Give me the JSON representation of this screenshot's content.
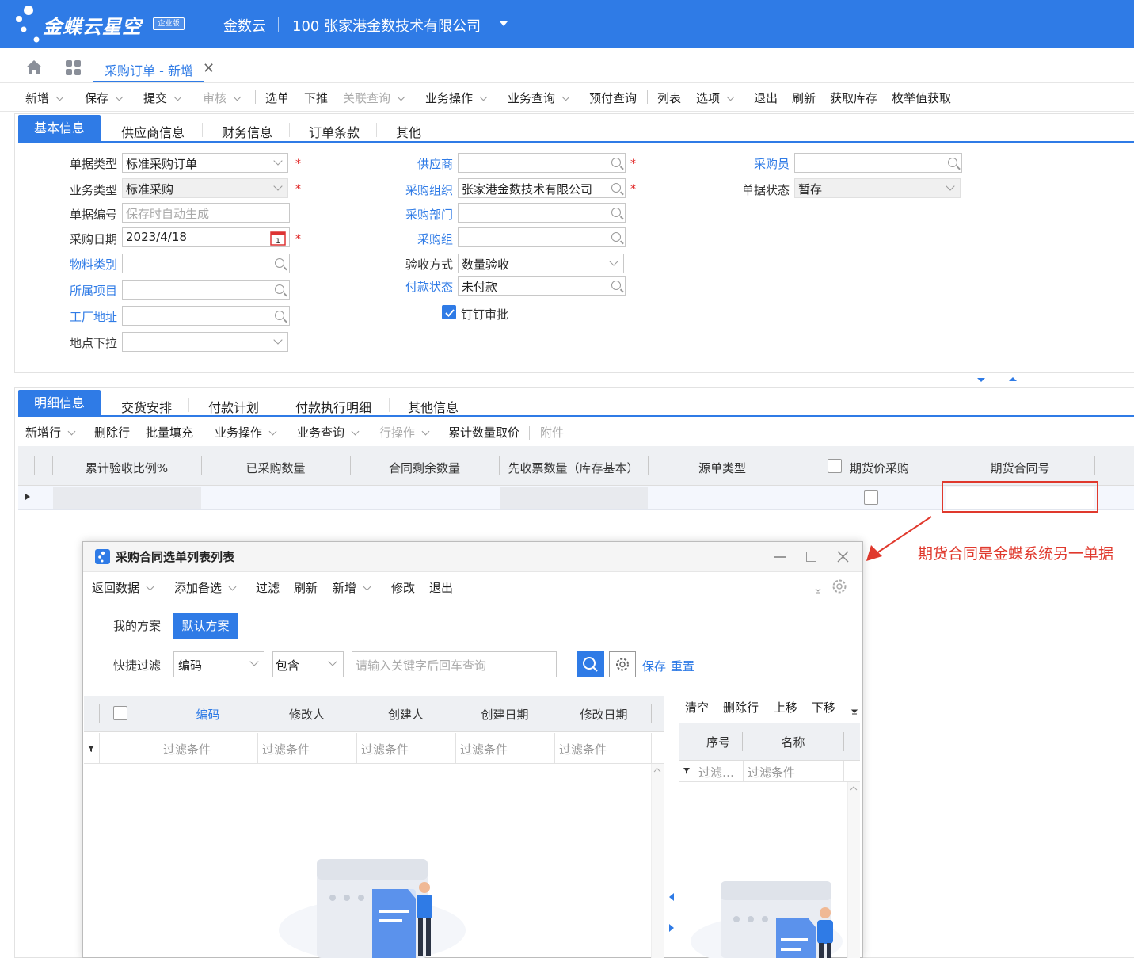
{
  "header": {
    "brand": "金蝶云星空",
    "badge": "企业版",
    "app": "金数云",
    "org": "100  张家港金数技术有限公司"
  },
  "tab": {
    "label": "采购订单 - 新增",
    "close": "✕"
  },
  "toolbar": [
    "新增",
    "保存",
    "提交",
    "审核",
    "选单",
    "下推",
    "关联查询",
    "业务操作",
    "业务查询",
    "预付查询",
    "列表",
    "选项",
    "退出",
    "刷新",
    "获取库存",
    "枚举值获取"
  ],
  "section_tabs": [
    "基本信息",
    "供应商信息",
    "财务信息",
    "订单条款",
    "其他"
  ],
  "form": {
    "doc_type_label": "单据类型",
    "doc_type": "标准采购订单",
    "biz_type_label": "业务类型",
    "biz_type": "标准采购",
    "doc_no_label": "单据编号",
    "doc_no_placeholder": "保存时自动生成",
    "date_label": "采购日期",
    "date": "2023/4/18",
    "material_label": "物料类别",
    "project_label": "所属项目",
    "factory_label": "工厂地址",
    "site_label": "地点下拉",
    "supplier_label": "供应商",
    "purch_org_label": "采购组织",
    "purch_org": "张家港金数技术有限公司",
    "dept_label": "采购部门",
    "group_label": "采购组",
    "accept_label": "验收方式",
    "accept": "数量验收",
    "pay_status_label": "付款状态",
    "pay_status": "未付款",
    "dingding_label": "钉钉审批",
    "buyer_label": "采购员",
    "state_label": "单据状态",
    "state": "暂存",
    "calendar_day": "1"
  },
  "detail_tabs": [
    "明细信息",
    "交货安排",
    "付款计划",
    "付款执行明细",
    "其他信息"
  ],
  "detail_toolbar": [
    "新增行",
    "删除行",
    "批量填充",
    "业务操作",
    "业务查询",
    "行操作",
    "累计数量取价",
    "附件"
  ],
  "grid_headers": [
    "累计验收比例%",
    "已采购数量",
    "合同剩余数量",
    "先收票数量（库存基本）",
    "源单类型",
    "期货价采购",
    "期货合同号"
  ],
  "annotation": "期货合同是金蝶系统另一单据",
  "dialog": {
    "title": "采购合同选单列表列表",
    "toolbar": [
      "返回数据",
      "添加备选",
      "过滤",
      "刷新",
      "新增",
      "修改",
      "退出"
    ],
    "my_scheme": "我的方案",
    "default_scheme": "默认方案",
    "quick_filter": "快捷过滤",
    "filter_field": "编码",
    "filter_op": "包含",
    "search_placeholder": "请输入关键字后回车查询",
    "save": "保存",
    "reset": "重置",
    "list_headers": [
      "编码",
      "修改人",
      "创建人",
      "创建日期",
      "修改日期"
    ],
    "filter_text": "过滤条件",
    "right_toolbar": [
      "清空",
      "删除行",
      "上移",
      "下移"
    ],
    "right_headers": [
      "序号",
      "名称"
    ],
    "right_filter_short": "过滤…"
  }
}
